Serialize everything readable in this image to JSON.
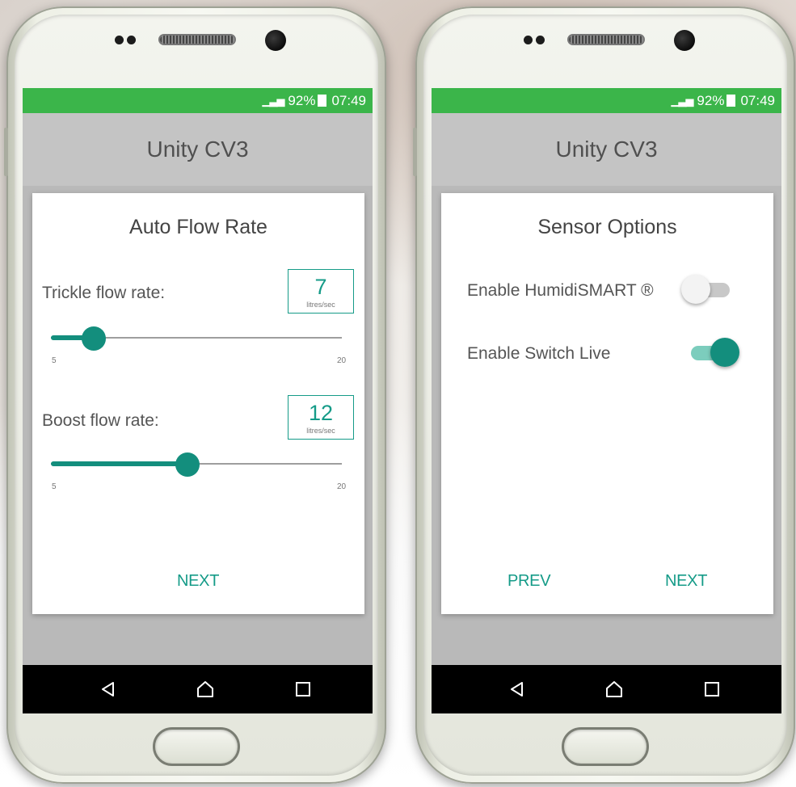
{
  "status_bar": {
    "signal": "▁▃▅",
    "battery_percent": "92%",
    "time": "07:49"
  },
  "app_title": "Unity CV3",
  "screen1": {
    "card_title": "Auto Flow Rate",
    "trickle": {
      "label": "Trickle flow rate:",
      "value": "7",
      "unit": "litres/sec",
      "min": "5",
      "max": "20",
      "fraction": 0.147
    },
    "boost": {
      "label": "Boost flow rate:",
      "value": "12",
      "unit": "litres/sec",
      "min": "5",
      "max": "20",
      "fraction": 0.47
    },
    "next_label": "NEXT"
  },
  "screen2": {
    "card_title": "Sensor Options",
    "options": [
      {
        "label": "Enable HumidiSMART ®",
        "enabled": false
      },
      {
        "label": "Enable Switch Live",
        "enabled": true
      }
    ],
    "prev_label": "PREV",
    "next_label": "NEXT"
  },
  "colors": {
    "status_bar": "#3bb54a",
    "accent": "#159b88",
    "app_bar": "#c4c4c4"
  },
  "nav_icons": [
    "back-icon",
    "home-icon",
    "recents-icon"
  ]
}
